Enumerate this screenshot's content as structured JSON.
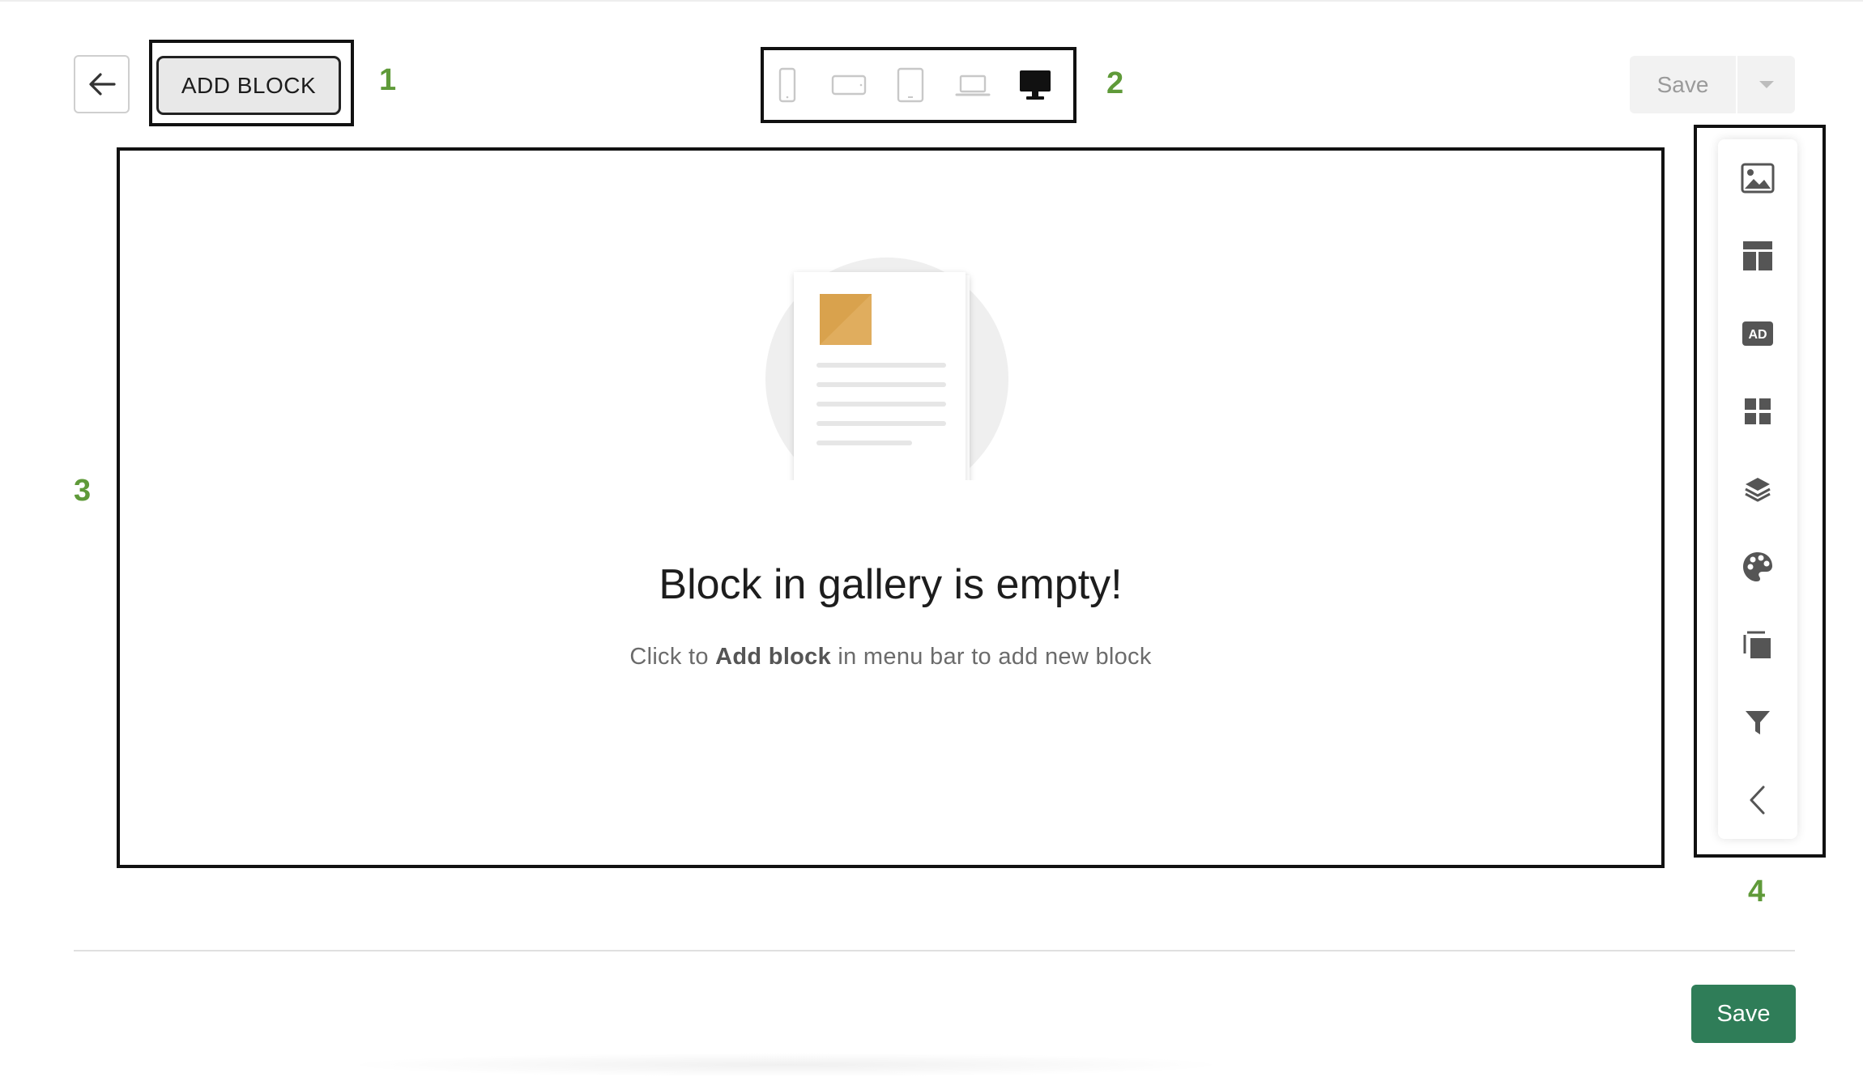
{
  "header": {
    "back_icon": "arrow-left-icon",
    "add_block_label": "ADD BLOCK",
    "save_label": "Save",
    "save_menu_icon": "caret-down-icon"
  },
  "device_switcher": {
    "devices": [
      {
        "name": "mobile-portrait",
        "icon": "phone-portrait-icon",
        "active": false
      },
      {
        "name": "mobile-landscape",
        "icon": "phone-landscape-icon",
        "active": false
      },
      {
        "name": "tablet",
        "icon": "tablet-icon",
        "active": false
      },
      {
        "name": "laptop",
        "icon": "laptop-icon",
        "active": false
      },
      {
        "name": "desktop",
        "icon": "desktop-icon",
        "active": true
      }
    ]
  },
  "canvas": {
    "empty_title": "Block in gallery is empty!",
    "empty_sub_prefix": "Click to ",
    "empty_sub_bold": "Add block",
    "empty_sub_suffix": " in menu bar to add new block"
  },
  "toolbar": {
    "items": [
      {
        "name": "image",
        "icon": "image-icon"
      },
      {
        "name": "layout",
        "icon": "layout-icon"
      },
      {
        "name": "ad",
        "icon": "ad-icon",
        "text": "AD"
      },
      {
        "name": "grid",
        "icon": "grid-icon"
      },
      {
        "name": "layers",
        "icon": "layers-icon"
      },
      {
        "name": "palette",
        "icon": "palette-icon"
      },
      {
        "name": "copy",
        "icon": "copy-icon"
      },
      {
        "name": "filter",
        "icon": "filter-icon"
      },
      {
        "name": "collapse",
        "icon": "chevron-left-icon"
      }
    ]
  },
  "callouts": {
    "n1": "1",
    "n2": "2",
    "n3": "3",
    "n4": "4"
  },
  "footer": {
    "save_label": "Save"
  },
  "colors": {
    "callout_number": "#5f9a39",
    "primary_button": "#2f7d58",
    "illustration_square": "#d9a24d"
  }
}
